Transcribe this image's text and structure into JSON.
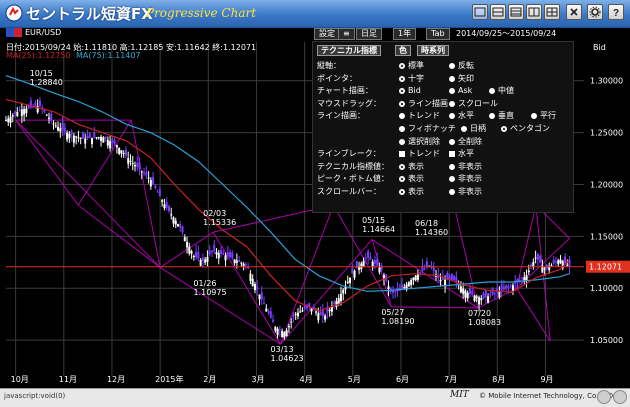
{
  "app": {
    "brand": "セントラル短資FX",
    "subtitle": "Progressive Chart",
    "status_bar": "javascript:void(0)",
    "footer_mark": "MIT",
    "copyright": "© Mobile Internet Technology, Co.,LTD."
  },
  "toolbar": {
    "symbol": "EUR/USD",
    "settings_label": "設定",
    "menu_label": "≡",
    "interval_label": "日足",
    "span_label": "1年",
    "tab_label": "Tab",
    "date_range": "2014/09/25～2015/09/24",
    "price_side": "Bid"
  },
  "info": {
    "ohlc": "日付:2015/09/24 始:1.11810 高:1.12185 安:1.11642 終:1.12071",
    "ma1": "MA(25):1.12750",
    "ma2": "MA(75):1.11407"
  },
  "panel": {
    "tabs": [
      "テクニカル指標",
      "色",
      "時系列"
    ],
    "rows": [
      {
        "label": "縦軸：",
        "options": [
          {
            "text": "標準",
            "sel": true,
            "kind": "radio"
          },
          {
            "text": "反転",
            "sel": false,
            "kind": "radio"
          }
        ]
      },
      {
        "label": "ポインタ：",
        "options": [
          {
            "text": "十字",
            "sel": true,
            "kind": "radio"
          },
          {
            "text": "矢印",
            "sel": false,
            "kind": "radio"
          }
        ]
      },
      {
        "label": "チャート描画：",
        "options": [
          {
            "text": "Bid",
            "sel": true,
            "kind": "radio"
          },
          {
            "text": "Ask",
            "sel": false,
            "kind": "radio"
          },
          {
            "text": "中値",
            "sel": false,
            "kind": "radio"
          }
        ]
      },
      {
        "label": "マウスドラッグ：",
        "options": [
          {
            "text": "ライン描画",
            "sel": true,
            "kind": "radio"
          },
          {
            "text": "スクロール",
            "sel": false,
            "kind": "radio"
          }
        ]
      },
      {
        "label": "ライン描画：",
        "options": [
          {
            "text": "トレンド",
            "sel": false,
            "kind": "radio"
          },
          {
            "text": "水平",
            "sel": false,
            "kind": "radio"
          },
          {
            "text": "垂直",
            "sel": false,
            "kind": "radio"
          },
          {
            "text": "平行",
            "sel": false,
            "kind": "radio"
          }
        ]
      },
      {
        "label": "",
        "options": [
          {
            "text": "フィボナッチ",
            "sel": false,
            "kind": "radio"
          },
          {
            "text": "日柄",
            "sel": false,
            "kind": "radio"
          },
          {
            "text": "ペンタゴン",
            "sel": true,
            "kind": "radio"
          }
        ]
      },
      {
        "label": "",
        "options": [
          {
            "text": "選択削除",
            "sel": false,
            "kind": "radio"
          },
          {
            "text": "全削除",
            "sel": false,
            "kind": "radio"
          }
        ]
      },
      {
        "label": "ラインブレーク：",
        "options": [
          {
            "text": "トレンド",
            "sel": false,
            "kind": "check"
          },
          {
            "text": "水平",
            "sel": false,
            "kind": "check"
          }
        ]
      },
      {
        "label": "テクニカル指標値：",
        "options": [
          {
            "text": "表示",
            "sel": true,
            "kind": "radio"
          },
          {
            "text": "非表示",
            "sel": false,
            "kind": "radio"
          }
        ]
      },
      {
        "label": "ピーク・ボトム値：",
        "options": [
          {
            "text": "表示",
            "sel": true,
            "kind": "radio"
          },
          {
            "text": "非表示",
            "sel": false,
            "kind": "radio"
          }
        ]
      },
      {
        "label": "スクロールバー：",
        "options": [
          {
            "text": "表示",
            "sel": true,
            "kind": "radio"
          },
          {
            "text": "非表示",
            "sel": false,
            "kind": "radio"
          }
        ]
      }
    ]
  },
  "chart_data": {
    "type": "candlestick",
    "ylim": [
      1.025,
      1.32
    ],
    "y_ticks": [
      "1.30000",
      "1.25000",
      "1.20000",
      "1.15000",
      "1.10000",
      "1.05000"
    ],
    "y_tick_values": [
      1.3,
      1.25,
      1.2,
      1.15,
      1.1,
      1.05
    ],
    "x_labels": [
      "10月",
      "11月",
      "12月",
      "2015年",
      "2月",
      "3月",
      "4月",
      "5月",
      "6月",
      "7月",
      "8月",
      "9月"
    ],
    "x_label_months": [
      0.2,
      1.2,
      2.2,
      3.2,
      4.2,
      5.2,
      6.2,
      7.2,
      8.2,
      9.2,
      10.2,
      11.2
    ],
    "current_price": "1.12071",
    "current_value": 1.12071,
    "peaks": [
      {
        "date": "10/15",
        "value": "1.28840",
        "t": 0.7,
        "v": 1.2884,
        "pos": "above"
      },
      {
        "date": "02/03",
        "value": "1.15336",
        "t": 4.3,
        "v": 1.15336,
        "pos": "above"
      },
      {
        "date": "01/26",
        "value": "1.10975",
        "t": 4.1,
        "v": 1.10975,
        "pos": "below"
      },
      {
        "date": "03/13",
        "value": "1.04623",
        "t": 5.7,
        "v": 1.04623,
        "pos": "below"
      },
      {
        "date": "05/15",
        "value": "1.14664",
        "t": 7.6,
        "v": 1.14664,
        "pos": "above"
      },
      {
        "date": "06/18",
        "value": "1.14360",
        "t": 8.7,
        "v": 1.1436,
        "pos": "above"
      },
      {
        "date": "05/27",
        "value": "1.08190",
        "t": 8.0,
        "v": 1.0819,
        "pos": "below"
      },
      {
        "date": "07/20",
        "value": "1.08083",
        "t": 9.8,
        "v": 1.08083,
        "pos": "below"
      }
    ],
    "close_path": [
      [
        0.0,
        1.262
      ],
      [
        0.3,
        1.272
      ],
      [
        0.7,
        1.276
      ],
      [
        1.0,
        1.258
      ],
      [
        1.3,
        1.249
      ],
      [
        1.6,
        1.244
      ],
      [
        2.0,
        1.246
      ],
      [
        2.3,
        1.238
      ],
      [
        2.6,
        1.222
      ],
      [
        3.0,
        1.205
      ],
      [
        3.3,
        1.18
      ],
      [
        3.6,
        1.16
      ],
      [
        3.9,
        1.131
      ],
      [
        4.1,
        1.126
      ],
      [
        4.3,
        1.136
      ],
      [
        4.6,
        1.131
      ],
      [
        5.0,
        1.122
      ],
      [
        5.3,
        1.09
      ],
      [
        5.6,
        1.062
      ],
      [
        5.8,
        1.057
      ],
      [
        6.0,
        1.075
      ],
      [
        6.3,
        1.082
      ],
      [
        6.6,
        1.072
      ],
      [
        6.9,
        1.09
      ],
      [
        7.2,
        1.115
      ],
      [
        7.5,
        1.13
      ],
      [
        7.8,
        1.118
      ],
      [
        8.0,
        1.095
      ],
      [
        8.2,
        1.098
      ],
      [
        8.5,
        1.112
      ],
      [
        8.8,
        1.122
      ],
      [
        9.0,
        1.108
      ],
      [
        9.3,
        1.108
      ],
      [
        9.6,
        1.095
      ],
      [
        9.9,
        1.09
      ],
      [
        10.2,
        1.096
      ],
      [
        10.5,
        1.102
      ],
      [
        10.8,
        1.112
      ],
      [
        11.0,
        1.13
      ],
      [
        11.2,
        1.118
      ],
      [
        11.5,
        1.128
      ],
      [
        11.7,
        1.121
      ]
    ],
    "ma25_path": [
      [
        0.0,
        1.282
      ],
      [
        0.5,
        1.276
      ],
      [
        1.0,
        1.27
      ],
      [
        1.5,
        1.258
      ],
      [
        2.0,
        1.25
      ],
      [
        2.5,
        1.242
      ],
      [
        3.0,
        1.226
      ],
      [
        3.5,
        1.2
      ],
      [
        4.0,
        1.176
      ],
      [
        4.5,
        1.156
      ],
      [
        5.0,
        1.14
      ],
      [
        5.5,
        1.112
      ],
      [
        6.0,
        1.088
      ],
      [
        6.5,
        1.078
      ],
      [
        7.0,
        1.086
      ],
      [
        7.5,
        1.102
      ],
      [
        8.0,
        1.112
      ],
      [
        8.5,
        1.114
      ],
      [
        9.0,
        1.112
      ],
      [
        9.5,
        1.103
      ],
      [
        10.0,
        1.098
      ],
      [
        10.5,
        1.096
      ],
      [
        11.0,
        1.11
      ],
      [
        11.5,
        1.118
      ],
      [
        11.7,
        1.1275
      ]
    ],
    "ma75_path": [
      [
        0.0,
        1.305
      ],
      [
        0.5,
        1.297
      ],
      [
        1.0,
        1.288
      ],
      [
        1.5,
        1.28
      ],
      [
        2.0,
        1.27
      ],
      [
        2.5,
        1.258
      ],
      [
        3.0,
        1.25
      ],
      [
        3.5,
        1.238
      ],
      [
        4.0,
        1.222
      ],
      [
        4.5,
        1.2
      ],
      [
        5.0,
        1.178
      ],
      [
        5.5,
        1.154
      ],
      [
        6.0,
        1.128
      ],
      [
        6.5,
        1.112
      ],
      [
        7.0,
        1.102
      ],
      [
        7.5,
        1.097
      ],
      [
        8.0,
        1.098
      ],
      [
        8.5,
        1.1
      ],
      [
        9.0,
        1.102
      ],
      [
        9.5,
        1.104
      ],
      [
        10.0,
        1.106
      ],
      [
        10.5,
        1.106
      ],
      [
        11.0,
        1.108
      ],
      [
        11.5,
        1.111
      ],
      [
        11.7,
        1.11407
      ]
    ]
  },
  "icons": {
    "colors": {
      "up": "#ffffff",
      "down": "#7a3cff",
      "ma25": "#c8202a",
      "ma75": "#2aa0d6",
      "pentagon": "#c000c0",
      "price": "#e0301e",
      "grid": "#3b3b3b"
    }
  }
}
